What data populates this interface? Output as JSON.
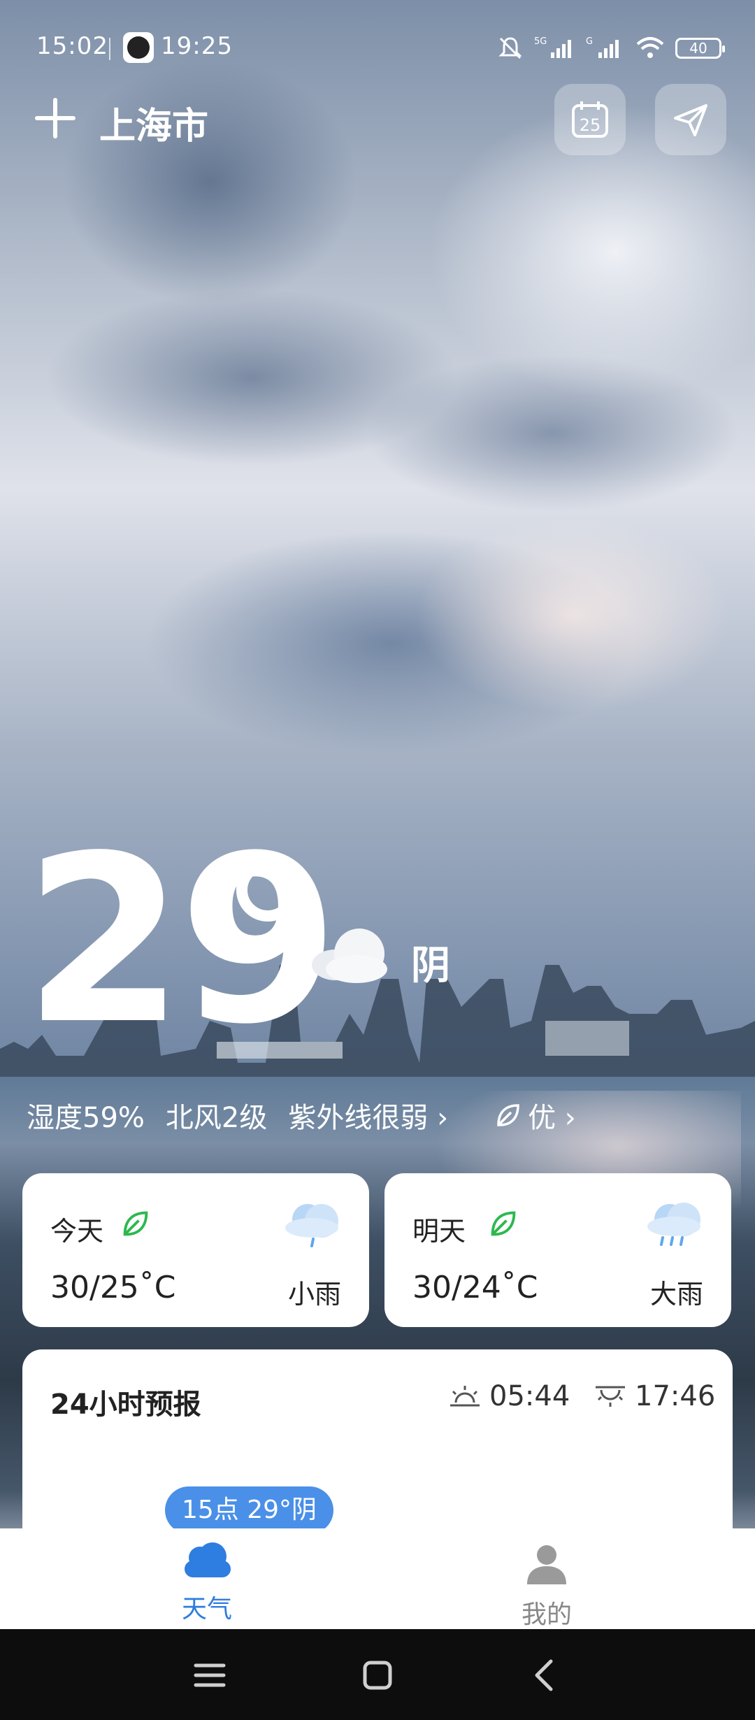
{
  "status_bar": {
    "time": "15:02",
    "clock": "19:25",
    "battery": "40"
  },
  "header": {
    "city": "上海市",
    "calendar_day": "25"
  },
  "current": {
    "temperature": "29",
    "condition": "阴",
    "humidity": "湿度59%",
    "wind": "北风2级",
    "uv": "紫外线很弱 ›",
    "air_quality": "优 ›"
  },
  "forecast_cards": [
    {
      "day": "今天",
      "range": "30/25˚C",
      "desc": "小雨"
    },
    {
      "day": "明天",
      "range": "30/24˚C",
      "desc": "大雨"
    }
  ],
  "hourly": {
    "title": "24小时预报",
    "sunrise": "05:44",
    "sunset": "17:46",
    "current_hour": "15点 29°阴"
  },
  "bottom_nav": {
    "weather": "天气",
    "mine": "我的"
  },
  "colors": {
    "accent": "#2e7de0",
    "pill": "#4a90e8",
    "leaf": "#2db84f"
  }
}
